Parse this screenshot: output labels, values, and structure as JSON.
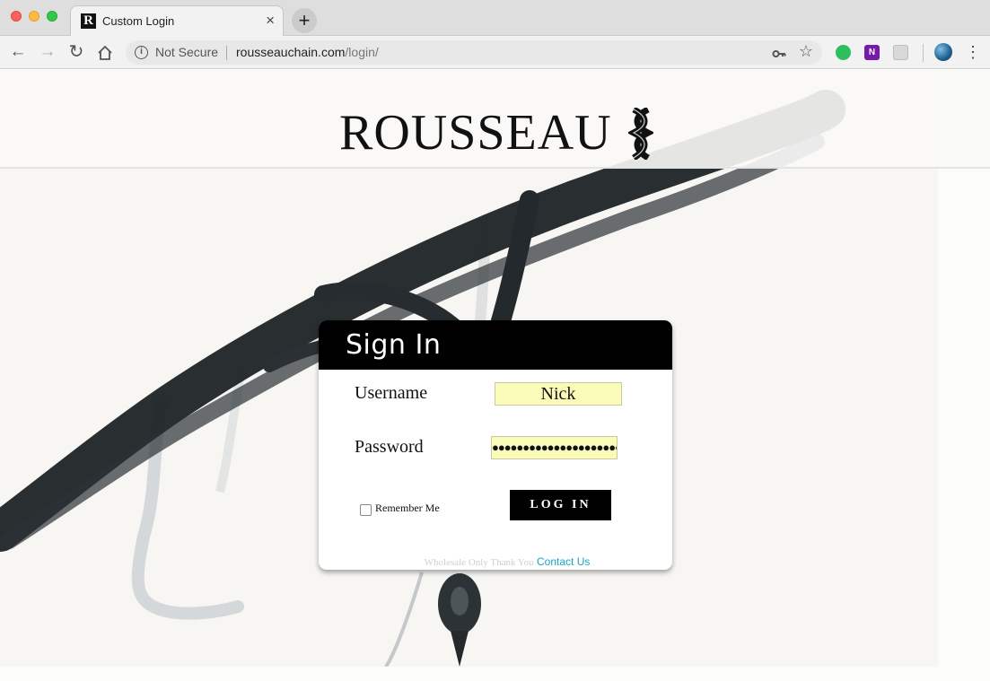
{
  "browser": {
    "tab_title": "Custom Login",
    "tab_favicon": "R",
    "new_tab_symbol": "+",
    "close_symbol": "×",
    "security_label": "Not Secure",
    "url_domain": "rousseauchain.com",
    "url_path": "/login/",
    "extensions": [
      "evernote-icon",
      "onenote-icon",
      "extension-icon"
    ],
    "onenote_letter": "N"
  },
  "brand": {
    "logo_text": "ROUSSEAU"
  },
  "login": {
    "title": "Sign In",
    "username_label": "Username",
    "username_value": "Nick",
    "password_label": "Password",
    "password_mask": "●●●●●●●●●●●●●●●●●●●●●",
    "remember_label": "Remember Me",
    "remember_checked": false,
    "submit_label": "LOG IN",
    "footer_text": "Wholesale Only Thank You",
    "contact_link": "Contact Us"
  },
  "colors": {
    "card_header": "#000000",
    "input_fill": "#fafbb9",
    "link": "#1aa3c2"
  }
}
